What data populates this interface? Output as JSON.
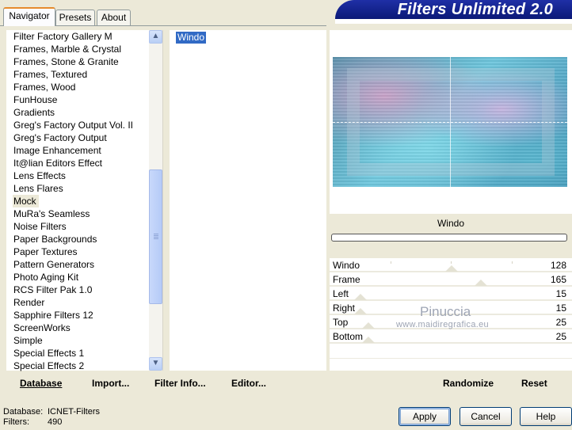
{
  "tabs": [
    {
      "label": "Navigator",
      "active": true
    },
    {
      "label": "Presets",
      "active": false
    },
    {
      "label": "About",
      "active": false
    }
  ],
  "banner": {
    "title": "Filters Unlimited 2.0"
  },
  "categories": [
    "Filter Factory Gallery M",
    "Frames, Marble & Crystal",
    "Frames, Stone & Granite",
    "Frames, Textured",
    "Frames, Wood",
    "FunHouse",
    "Gradients",
    "Greg's Factory Output Vol. II",
    "Greg's Factory Output",
    "Image Enhancement",
    "It@lian Editors Effect",
    "Lens Effects",
    "Lens Flares",
    "Mock",
    "MuRa's Seamless",
    "Noise Filters",
    "Paper Backgrounds",
    "Paper Textures",
    "Pattern Generators",
    "Photo Aging Kit",
    "RCS Filter Pak 1.0",
    "Render",
    "Sapphire Filters 12",
    "ScreenWorks",
    "Simple",
    "Special Effects 1",
    "Special Effects 2"
  ],
  "selected_category": "Mock",
  "filters": [
    "Windo"
  ],
  "selected_filter": "Windo",
  "filter_name_display": "Windo",
  "progress_fraction": 0,
  "parameters": [
    {
      "label": "Windo",
      "value": "128",
      "fraction": 0.502
    },
    {
      "label": "Frame",
      "value": "165",
      "fraction": 0.647
    },
    {
      "label": "Left",
      "value": "15",
      "fraction": 0.059
    },
    {
      "label": "Right",
      "value": "15",
      "fraction": 0.059
    },
    {
      "label": "Top",
      "value": "25",
      "fraction": 0.098
    },
    {
      "label": "Bottom",
      "value": "25",
      "fraction": 0.098
    }
  ],
  "watermark": {
    "name": "Pinuccia",
    "site": "www.maidiregrafica.eu"
  },
  "bottom_buttons": {
    "database": "Database",
    "import": "Import...",
    "filter_info": "Filter Info...",
    "editor": "Editor...",
    "randomize": "Randomize",
    "reset": "Reset"
  },
  "status": {
    "database_label": "Database:",
    "database_value": "ICNET-Filters",
    "filters_label": "Filters:",
    "filters_value": "490"
  },
  "dialog_buttons": {
    "apply": "Apply",
    "cancel": "Cancel",
    "help": "Help"
  },
  "colors": {
    "selection": "#316ac5",
    "banner": "#0b1977",
    "panel": "#ece9d8"
  }
}
